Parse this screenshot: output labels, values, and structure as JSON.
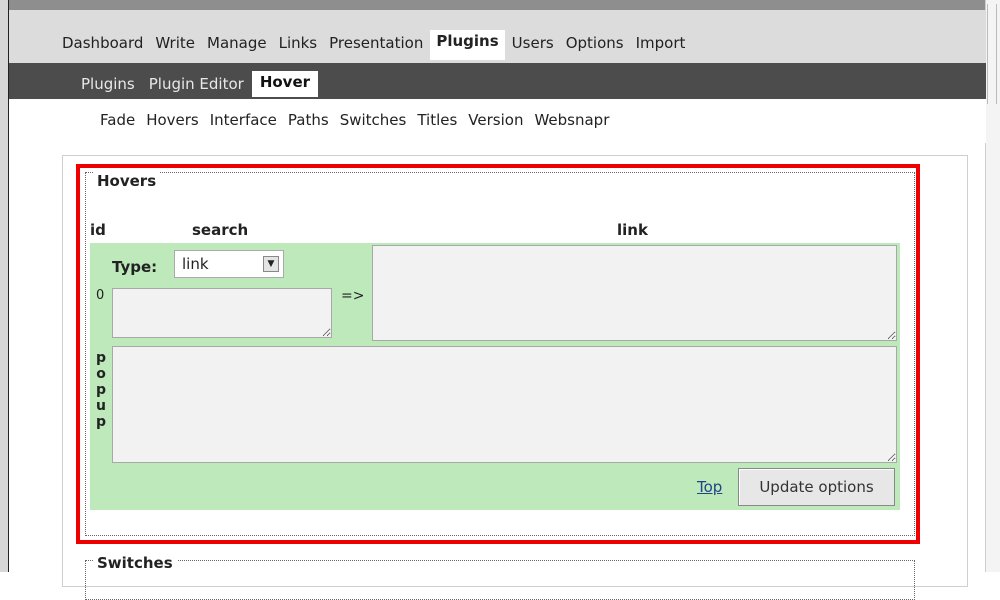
{
  "menu_main": {
    "items": [
      "Dashboard",
      "Write",
      "Manage",
      "Links",
      "Presentation",
      "Plugins",
      "Users",
      "Options",
      "Import"
    ],
    "active": "Plugins"
  },
  "menu_sub": {
    "items": [
      "Plugins",
      "Plugin Editor",
      "Hover"
    ],
    "active": "Hover"
  },
  "menu_third": {
    "items": [
      "Fade",
      "Hovers",
      "Interface",
      "Paths",
      "Switches",
      "Titles",
      "Version",
      "Websnapr"
    ]
  },
  "hovers": {
    "legend": "Hovers",
    "headers": {
      "id": "id",
      "search": "search",
      "link": "link"
    },
    "type_label": "Type:",
    "type_value": "link",
    "row_id": "0",
    "arrow": "=>",
    "popup_letters": [
      "p",
      "o",
      "p",
      "u",
      "p"
    ],
    "top_link": "Top",
    "update_button": "Update options"
  },
  "switches": {
    "legend": "Switches"
  },
  "colors": {
    "highlight": "#ee0000",
    "row_bg": "#bde9bb",
    "submenu_bg": "#4c4c4c",
    "menu_bg": "#dcdcdc"
  }
}
